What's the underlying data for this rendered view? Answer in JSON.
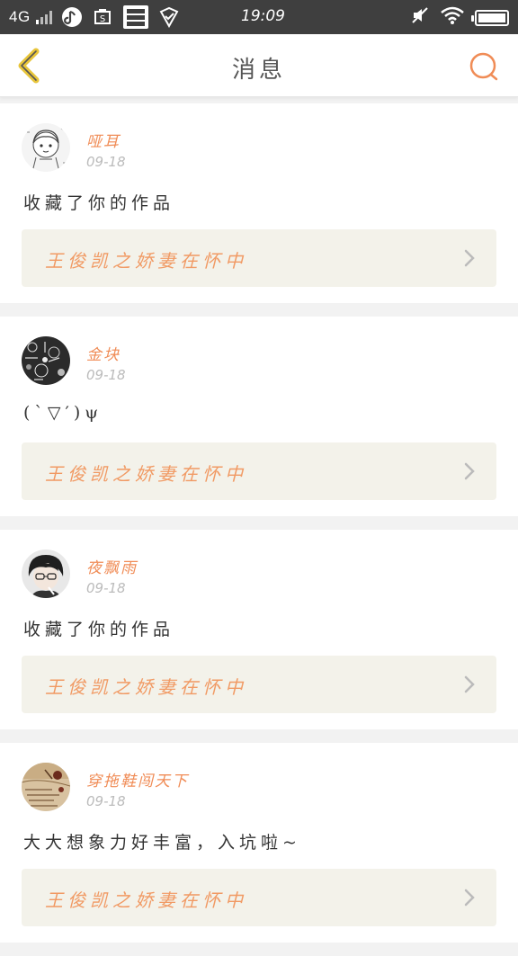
{
  "status_bar": {
    "network": "4G",
    "time": "19:09"
  },
  "header": {
    "title": "消息",
    "back_icon": "chevron-left-icon",
    "search_icon": "search-icon"
  },
  "colors": {
    "accent": "#f08c56",
    "back_icon_color": "#e8c53a",
    "link_bg": "#f3f2ea"
  },
  "messages": [
    {
      "username": "哑耳",
      "date": "09-18",
      "text": "收藏了你的作品",
      "work_title": "王俊凯之娇妻在怀中"
    },
    {
      "username": "金块",
      "date": "09-18",
      "text": "(`▽′)ψ",
      "work_title": "王俊凯之娇妻在怀中"
    },
    {
      "username": "夜飘雨",
      "date": "09-18",
      "text": "收藏了你的作品",
      "work_title": "王俊凯之娇妻在怀中"
    },
    {
      "username": "穿拖鞋闯天下",
      "date": "09-18",
      "text": "大大想象力好丰富，入坑啦~",
      "work_title": "王俊凯之娇妻在怀中"
    }
  ]
}
